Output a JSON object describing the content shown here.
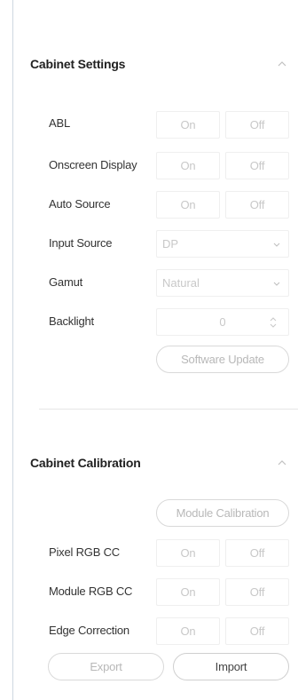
{
  "settings": {
    "title": "Cabinet Settings",
    "collapse_icon": "chevron-up-icon",
    "rows": {
      "abl": {
        "label": "ABL",
        "on": "On",
        "off": "Off"
      },
      "osd": {
        "label": "Onscreen Display",
        "on": "On",
        "off": "Off"
      },
      "auto_source": {
        "label": "Auto Source",
        "on": "On",
        "off": "Off"
      },
      "input_source": {
        "label": "Input Source",
        "value": "DP"
      },
      "gamut": {
        "label": "Gamut",
        "value": "Natural"
      },
      "backlight": {
        "label": "Backlight",
        "value": "0"
      }
    },
    "software_update_label": "Software Update"
  },
  "calibration": {
    "title": "Cabinet Calibration",
    "collapse_icon": "chevron-up-icon",
    "module_calibration_label": "Module Calibration",
    "rows": {
      "pixel_rgb": {
        "label": "Pixel RGB CC",
        "on": "On",
        "off": "Off"
      },
      "module_rgb": {
        "label": "Module RGB CC",
        "on": "On",
        "off": "Off"
      },
      "edge": {
        "label": "Edge Correction",
        "on": "On",
        "off": "Off"
      }
    },
    "export_label": "Export",
    "import_label": "Import"
  },
  "colors": {
    "panel_border": "#cfd8e0",
    "disabled_text": "#c8c8c8",
    "control_border": "#efefef"
  }
}
